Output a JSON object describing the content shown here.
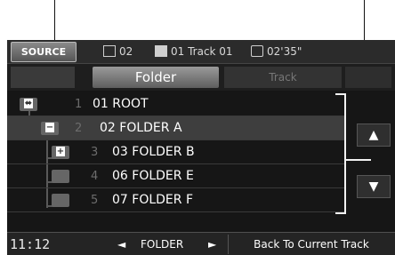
{
  "topbar": {
    "source_label": "SOURCE",
    "folder_number": "02",
    "track_info": "01 Track 01",
    "elapsed_time": "02'35\""
  },
  "tabs": {
    "folder_label": "Folder",
    "track_label": "Track"
  },
  "rows": [
    {
      "number": "1",
      "label": "01 ROOT",
      "icon": "usb-icon"
    },
    {
      "number": "2",
      "label": "02 FOLDER A",
      "icon": "folder-collapse-icon",
      "glyph": "−",
      "selected": true
    },
    {
      "number": "3",
      "label": "03 FOLDER B",
      "icon": "folder-expand-icon",
      "glyph": "+"
    },
    {
      "number": "4",
      "label": "06 FOLDER E",
      "icon": "folder-icon"
    },
    {
      "number": "5",
      "label": "07 FOLDER F",
      "icon": "folder-icon"
    }
  ],
  "bottombar": {
    "clock": "11:12",
    "prev_arrow": "◄",
    "nav_label": "FOLDER",
    "next_arrow": "►",
    "back_label": "Back To Current Track"
  },
  "scroll": {
    "up": "▲",
    "down": "▼"
  },
  "colors": {
    "screen_bg": "#161616",
    "selected_row": "#3e3e3e",
    "text": "#ffffff"
  }
}
